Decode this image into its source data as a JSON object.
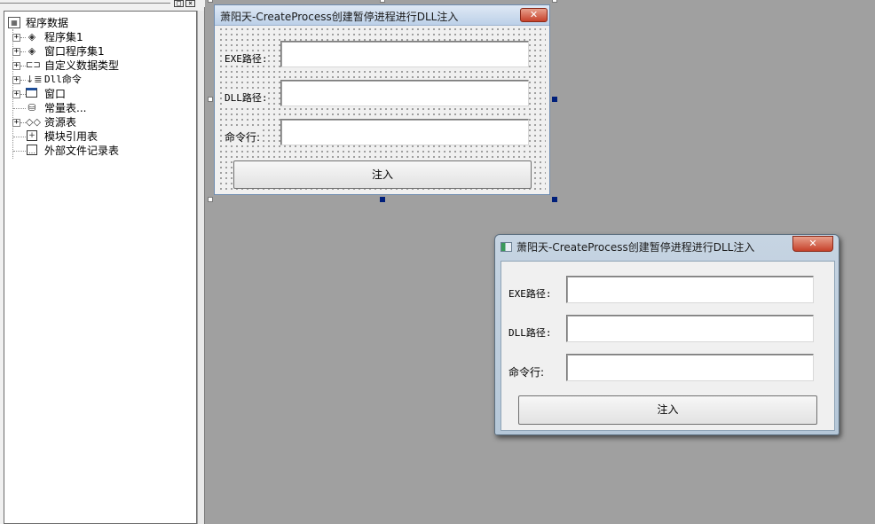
{
  "panel": {
    "pin_label": "□",
    "close_label": "×"
  },
  "tree": {
    "root": {
      "label": "程序数据",
      "icon": "program-data-icon"
    },
    "items": [
      {
        "label": "程序集1",
        "icon": "assembly-icon",
        "expandable": true
      },
      {
        "label": "窗口程序集1",
        "icon": "window-assembly-icon",
        "expandable": true
      },
      {
        "label": "自定义数据类型",
        "icon": "data-type-icon",
        "expandable": true
      },
      {
        "label": "Dll命令",
        "icon": "dll-command-icon",
        "expandable": true
      },
      {
        "label": "窗口",
        "icon": "window-icon",
        "expandable": true
      },
      {
        "label": "常量表...",
        "icon": "constant-table-icon",
        "expandable": false
      },
      {
        "label": "资源表",
        "icon": "resource-table-icon",
        "expandable": true
      },
      {
        "label": "模块引用表",
        "icon": "module-reference-icon",
        "expandable": false
      },
      {
        "label": "外部文件记录表",
        "icon": "external-file-icon",
        "expandable": false
      }
    ]
  },
  "design_form": {
    "title": "萧阳天-CreateProcess创建暂停进程进行DLL注入",
    "close_label": "✕",
    "exe_label": "EXE路径:",
    "dll_label": "DLL路径:",
    "cmd_label": "命令行:",
    "exe_value": "",
    "dll_value": "",
    "cmd_value": "",
    "inject_label": "注入"
  },
  "runtime_window": {
    "title": "萧阳天-CreateProcess创建暂停进程进行DLL注入",
    "close_label": "✕",
    "exe_label": "EXE路径:",
    "dll_label": "DLL路径:",
    "cmd_label": "命令行:",
    "exe_value": "",
    "dll_value": "",
    "cmd_value": "",
    "inject_label": "注入"
  }
}
